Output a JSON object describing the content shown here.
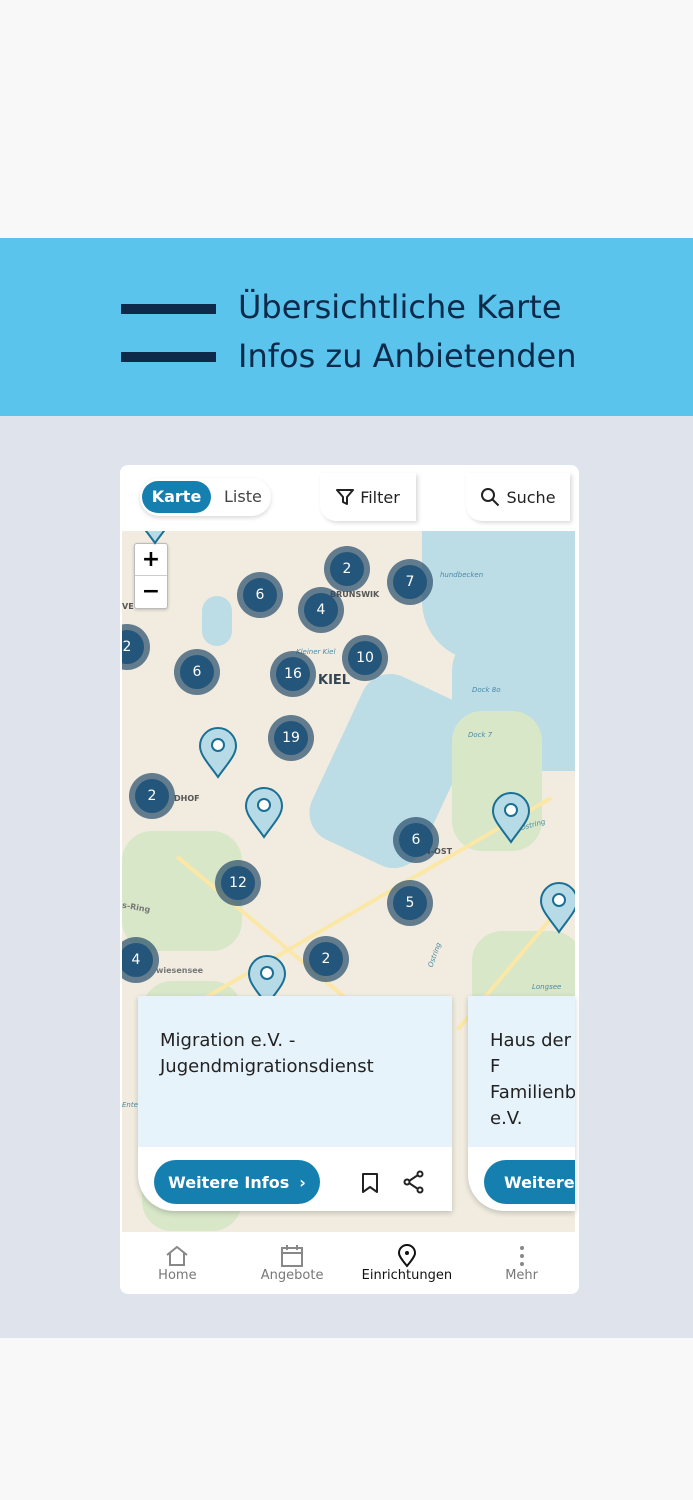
{
  "banner": {
    "lines": [
      "Übersichtliche Karte",
      "Infos zu Anbietenden"
    ]
  },
  "toolbar": {
    "karte": "Karte",
    "liste": "Liste",
    "filter": "Filter",
    "search": "Suche"
  },
  "map": {
    "zoom_in": "+",
    "zoom_out": "−",
    "labels": {
      "brunswik": "BRUNSWIK",
      "kiel": "KIEL",
      "kleiner_kiel": "Kleiner Kiel",
      "becken": "hundbecken",
      "dock8": "Dock 8o",
      "dock7": "Dock 7",
      "ost": "N-OST",
      "ostring1": "Ostring",
      "ostring2": "Ostring",
      "longsee": "Longsee",
      "wiesensee": "wiesensee",
      "dhof": "DHOF",
      "ve": "VE",
      "ring": "s-Ring",
      "ente": "Ente"
    },
    "clusters": [
      "2",
      "7",
      "6",
      "4",
      "2",
      "6",
      "16",
      "10",
      "19",
      "2",
      "6",
      "12",
      "5",
      "4",
      "2"
    ]
  },
  "cards": [
    {
      "title": "Migration e.V. - Jugendmigrationsdienst",
      "button": "Weitere Infos"
    },
    {
      "title": "Haus der F Familienb e.V.",
      "button": "Weitere In"
    }
  ],
  "nav": [
    {
      "label": "Home"
    },
    {
      "label": "Angebote"
    },
    {
      "label": "Einrichtungen"
    },
    {
      "label": "Mehr"
    }
  ],
  "colors": {
    "accent": "#1580b0",
    "banner": "#5bc4ec",
    "cluster": "#24557a"
  }
}
